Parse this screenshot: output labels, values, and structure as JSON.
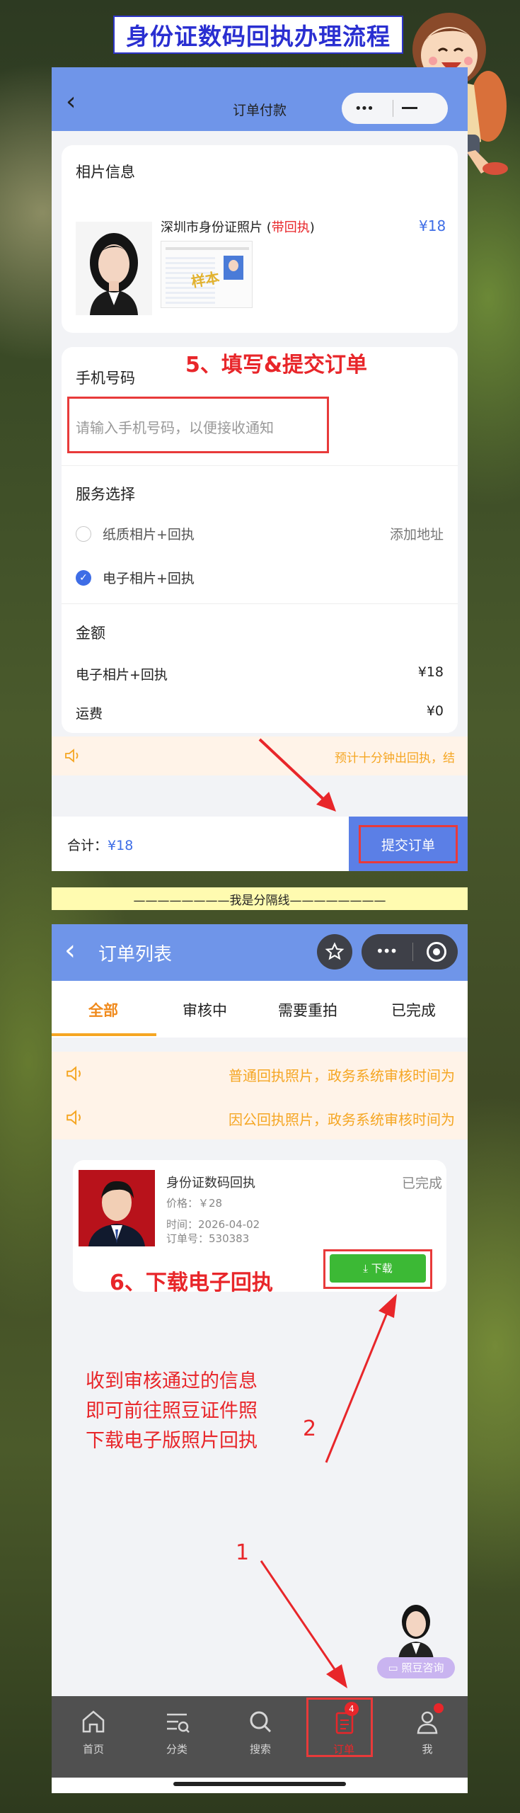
{
  "banner": {
    "title": "身份证数码回执办理流程"
  },
  "screen1": {
    "nav_title": "订单付款",
    "photo_section": {
      "heading": "相片信息",
      "item_name": "深圳市身份证照片",
      "item_badge": "带回执",
      "price": "¥18",
      "sample_stamp": "样本"
    },
    "step_label": "5、填写&提交订单",
    "phone": {
      "label": "手机号码",
      "placeholder": "请输入手机号码，以便接收通知"
    },
    "service": {
      "heading": "服务选择",
      "options": [
        {
          "label": "纸质相片+回执",
          "selected": false,
          "extra": "添加地址"
        },
        {
          "label": "电子相片+回执",
          "selected": true,
          "extra": ""
        }
      ]
    },
    "amount": {
      "heading": "金额",
      "rows": [
        {
          "label": "电子相片+回执",
          "value": "¥18"
        },
        {
          "label": "运费",
          "value": "¥0"
        }
      ]
    },
    "notice": "预计十分钟出回执，结",
    "footer": {
      "total_label": "合计：",
      "total_value": "¥18",
      "submit_label": "提交订单"
    }
  },
  "divider_text": "————————我是分隔线————————",
  "screen2": {
    "nav_title": "订单列表",
    "tabs": [
      "全部",
      "审核中",
      "需要重拍",
      "已完成"
    ],
    "active_tab": 0,
    "notices": [
      "普通回执照片，政务系统审核时间为",
      "因公回执照片，政务系统审核时间为"
    ],
    "order": {
      "title": "身份证数码回执",
      "status": "已完成",
      "price": "价格：￥28",
      "time": "时间：2026-04-02",
      "order_no": "订单号：530383",
      "download_label": "下载"
    },
    "step_label": "6、下载电子回执",
    "instruction_lines": [
      "收到审核通过的信息",
      "即可前往照豆证件照",
      "下载电子版照片回执"
    ],
    "marker_2": "2",
    "marker_1": "1",
    "consult_label": "照豆咨询",
    "tabbar": [
      {
        "label": "首页",
        "icon": "home-icon"
      },
      {
        "label": "分类",
        "icon": "category-icon"
      },
      {
        "label": "搜索",
        "icon": "search-icon"
      },
      {
        "label": "订单",
        "icon": "order-icon",
        "badge": "4",
        "active": true
      },
      {
        "label": "我",
        "icon": "profile-icon"
      }
    ]
  },
  "colors": {
    "nav": "#6f95e9",
    "accent_red": "#e8262a",
    "accent_orange": "#f5a623",
    "download_green": "#3cb935"
  }
}
